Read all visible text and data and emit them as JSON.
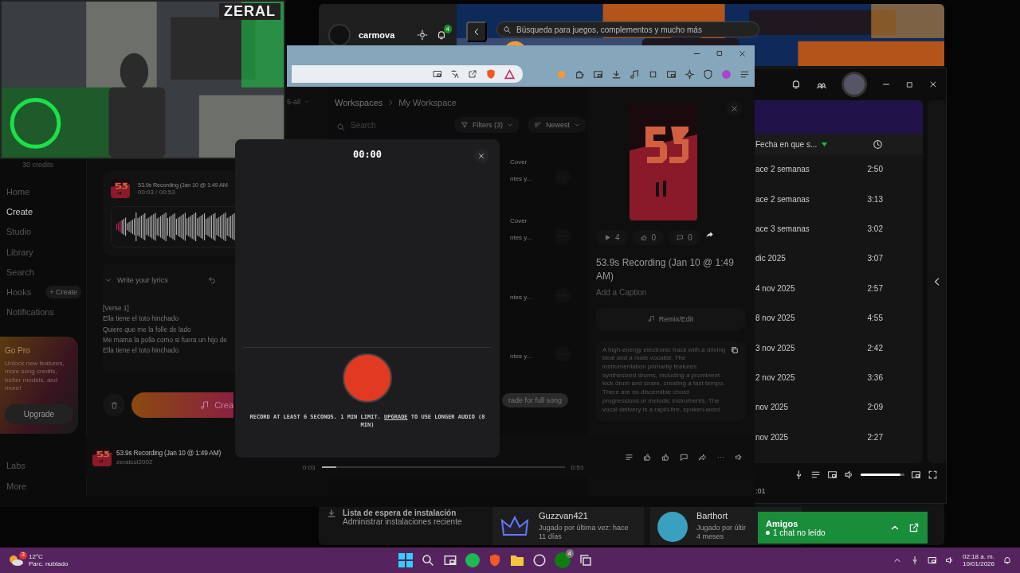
{
  "webcam": {
    "overlay_label": "ZERAL"
  },
  "xbox": {
    "user": "carmova",
    "notifications": "4",
    "search": {
      "placeholder": "Búsqueda para juegos, complementos y mucho más"
    },
    "install_queue": {
      "title": "Lista de espera de instalación",
      "subtitle": "Administrar instalaciones reciente"
    },
    "friends": [
      {
        "name": "Guzzvan421",
        "status": "Jugado por última vez: hace",
        "time": "11 días"
      },
      {
        "name": "Barthort",
        "status": "Jugado por últir",
        "time": "4 meses"
      }
    ],
    "chat": {
      "title": "Amigos",
      "unread": "1 chat no leído"
    }
  },
  "browser": {
    "sidebar": {
      "credits": "30 credits",
      "items": [
        {
          "label": "Home",
          "selected": false
        },
        {
          "label": "Create",
          "selected": true
        },
        {
          "label": "Studio",
          "selected": false
        },
        {
          "label": "Library",
          "selected": false
        },
        {
          "label": "Search",
          "selected": false
        },
        {
          "label": "Hooks",
          "selected": false,
          "action": "+ Create"
        },
        {
          "label": "Notifications",
          "selected": false
        }
      ],
      "promo": {
        "title": "Go Pro",
        "text": "Unlock new features, more song credits, better models, and more!",
        "button": "Upgrade"
      },
      "bottom_items": [
        "Labs",
        "More"
      ]
    },
    "recording": {
      "title": "53.9s Recording (Jan 10 @ 1:49 AM",
      "time": "00:03 / 00:53"
    },
    "lyrics": {
      "label": "Write your lyrics",
      "lines": [
        "[Verse 1]",
        "Ella tiene el toto hinchado",
        "Quiere que me la folle de lado",
        "Me mama la polla como si fuera un hijo de",
        "Ella tiene el toto hinchado"
      ]
    },
    "create_button": "Crea",
    "workspace": {
      "dropdown": "5-all",
      "breadcrumb": [
        "Workspaces",
        "My Workspace"
      ],
      "search": {
        "placeholder": "Search"
      },
      "filters": "Filters (3)",
      "sort": "Newest",
      "rows": [
        {
          "tag": "Cover",
          "snippet": "ntes y..."
        },
        {
          "tag": "Cover",
          "snippet": "ntes y..."
        },
        {
          "snippet": "ntes y..."
        },
        {
          "snippet": "ntes y..."
        }
      ],
      "upgrade_pill": "rade for full song"
    },
    "details": {
      "plays": "4",
      "likes": "0",
      "comments": "0",
      "title": "53.9s Recording (Jan 10 @ 1:49 AM)",
      "caption": "Add a Caption",
      "remix": "Remix/Edit",
      "description": "A high-energy electronic track with a driving beat and a male vocalist. The instrumentation primarily features synthesized drums, including a prominent kick drum and snare, creating a fast tempo. There are no discernible chord progressions or melodic instruments. The vocal delivery is a rapid-fire, spoken-word"
    },
    "player": {
      "title": "53.9s Recording (Jan 10 @ 1:49 AM)",
      "artist": "zeralcol2002",
      "elapsed": "0:03",
      "total": "0:53",
      "level": 0.06
    }
  },
  "modal": {
    "timer": "00:00",
    "hint_before": "RECORD AT LEAST 6 SECONDS. 1 MIN LIMIT.",
    "hint_link": "UPGRADE",
    "hint_after": "TO USE LONGER AUDIO (8 MIN)"
  },
  "spotify": {
    "column": "Fecha en que s...",
    "rows": [
      {
        "date": "ace 2 semanas",
        "duration": "2:50"
      },
      {
        "date": "ace 2 semanas",
        "duration": "3:13"
      },
      {
        "date": "ace 3 semanas",
        "duration": "3:02"
      },
      {
        "date": "dic 2025",
        "duration": "3:07"
      },
      {
        "date": "4 nov 2025",
        "duration": "2:57"
      },
      {
        "date": "8 nov 2025",
        "duration": "4:55"
      },
      {
        "date": "3 nov 2025",
        "duration": "2:42"
      },
      {
        "date": "2 nov 2025",
        "duration": "3:36"
      },
      {
        "date": "nov 2025",
        "duration": "2:09"
      },
      {
        "date": "nov 2025",
        "duration": "2:27"
      }
    ],
    "elapsed": ":01",
    "volume": {
      "level": 0.9
    }
  },
  "taskbar": {
    "temperature": "12°C",
    "weather": "Parc. nublado",
    "weather_badge": "3",
    "time": "02:18 a. m.",
    "date": "10/01/2026",
    "xbox_badge": "4"
  }
}
